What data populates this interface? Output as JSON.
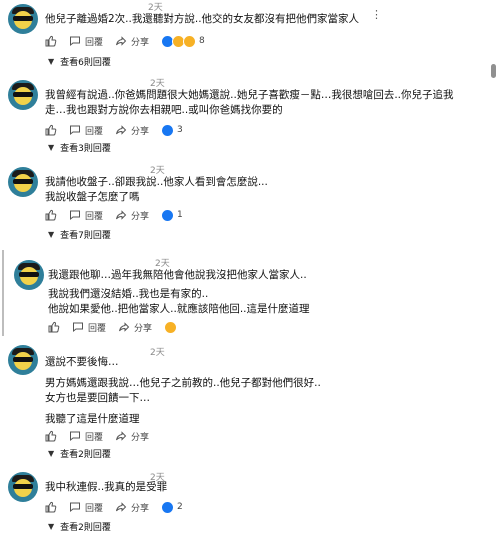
{
  "labels": {
    "reply": "回覆",
    "share": "分享"
  },
  "comments": [
    {
      "time": "2天",
      "lines": [
        "他兒子離過婚2次..我還聽對方說..他交的女友都沒有把他們家當家人"
      ],
      "count": "8",
      "replies": "查看6則回覆",
      "reactions": [
        "like",
        "haha",
        "wow"
      ]
    },
    {
      "time": "2天",
      "lines": [
        "我曾經有說過..你爸媽問題很大她媽還說..她兒子喜歡瘦－點…我很想嗆回去..你兒子追我",
        "走…我也跟對方說你去相親吧..或叫你爸媽找你要的"
      ],
      "count": "3",
      "replies": "查看3則回覆",
      "reactions": [
        "like"
      ]
    },
    {
      "time": "2天",
      "lines": [
        "我請他收盤子..卻跟我說..他家人看到會怎麼說...",
        "我說收盤子怎麼了嗎"
      ],
      "count": "1",
      "replies": "查看7則回覆",
      "reactions": [
        "like"
      ]
    },
    {
      "time": "2天",
      "lines": [
        "我還跟他聊…過年我無陪他會他說我沒把他家人當家人..",
        "我說我們還沒結婚..我也是有家的..",
        "他說如果愛他..把他當家人..就應該陪他回..這是什麼道理"
      ],
      "count": "",
      "replies": "",
      "reactions": [
        "haha"
      ]
    },
    {
      "time": "2天",
      "lines": [
        "還說不要後悔…",
        "男方媽媽還跟我說…他兒子之前教的..他兒子都對他們很好..",
        "女方也是要回饋一下…",
        "我聽了這是什麼道理"
      ],
      "count": "",
      "replies": "查看2則回覆",
      "reactions": []
    },
    {
      "time": "2天",
      "lines": [
        "我中秋連假..我真的是受罪"
      ],
      "count": "2",
      "replies": "查看2則回覆",
      "reactions": [
        "like"
      ]
    }
  ]
}
